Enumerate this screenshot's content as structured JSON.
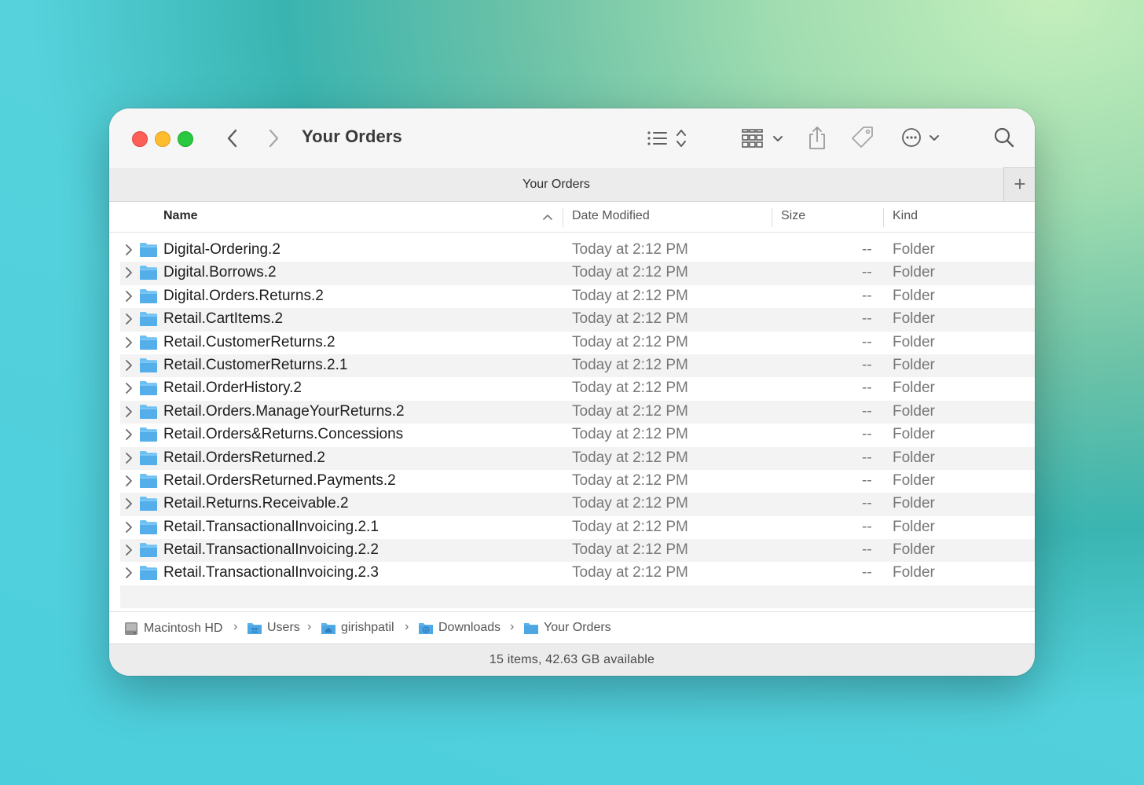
{
  "window": {
    "title": "Your Orders"
  },
  "toolbar": {
    "back_icon": "chevron-left-icon",
    "forward_icon": "chevron-right-icon",
    "view_icon": "list-view-icon",
    "group_icon": "grid-group-icon",
    "share_icon": "share-icon",
    "tag_icon": "tag-icon",
    "more_icon": "ellipsis-circle-icon",
    "search_icon": "search-icon"
  },
  "tab": {
    "title": "Your Orders",
    "add_label": "+"
  },
  "columns": {
    "name": "Name",
    "date": "Date Modified",
    "size": "Size",
    "kind": "Kind"
  },
  "files": [
    {
      "name": "Digital-Ordering.2",
      "date": "Today at 2:12 PM",
      "size": "--",
      "kind": "Folder"
    },
    {
      "name": "Digital.Borrows.2",
      "date": "Today at 2:12 PM",
      "size": "--",
      "kind": "Folder"
    },
    {
      "name": "Digital.Orders.Returns.2",
      "date": "Today at 2:12 PM",
      "size": "--",
      "kind": "Folder"
    },
    {
      "name": "Retail.CartItems.2",
      "date": "Today at 2:12 PM",
      "size": "--",
      "kind": "Folder"
    },
    {
      "name": "Retail.CustomerReturns.2",
      "date": "Today at 2:12 PM",
      "size": "--",
      "kind": "Folder"
    },
    {
      "name": "Retail.CustomerReturns.2.1",
      "date": "Today at 2:12 PM",
      "size": "--",
      "kind": "Folder"
    },
    {
      "name": "Retail.OrderHistory.2",
      "date": "Today at 2:12 PM",
      "size": "--",
      "kind": "Folder"
    },
    {
      "name": "Retail.Orders.ManageYourReturns.2",
      "date": "Today at 2:12 PM",
      "size": "--",
      "kind": "Folder"
    },
    {
      "name": "Retail.Orders&Returns.Concessions",
      "date": "Today at 2:12 PM",
      "size": "--",
      "kind": "Folder"
    },
    {
      "name": "Retail.OrdersReturned.2",
      "date": "Today at 2:12 PM",
      "size": "--",
      "kind": "Folder"
    },
    {
      "name": "Retail.OrdersReturned.Payments.2",
      "date": "Today at 2:12 PM",
      "size": "--",
      "kind": "Folder"
    },
    {
      "name": "Retail.Returns.Receivable.2",
      "date": "Today at 2:12 PM",
      "size": "--",
      "kind": "Folder"
    },
    {
      "name": "Retail.TransactionalInvoicing.2.1",
      "date": "Today at 2:12 PM",
      "size": "--",
      "kind": "Folder"
    },
    {
      "name": "Retail.TransactionalInvoicing.2.2",
      "date": "Today at 2:12 PM",
      "size": "--",
      "kind": "Folder"
    },
    {
      "name": "Retail.TransactionalInvoicing.2.3",
      "date": "Today at 2:12 PM",
      "size": "--",
      "kind": "Folder"
    }
  ],
  "path": [
    {
      "label": "Macintosh HD",
      "icon": "hard-drive-icon"
    },
    {
      "label": "Users",
      "icon": "users-folder-icon"
    },
    {
      "label": "girishpatil",
      "icon": "home-folder-icon"
    },
    {
      "label": "Downloads",
      "icon": "downloads-folder-icon"
    },
    {
      "label": "Your Orders",
      "icon": "folder-icon"
    }
  ],
  "status": {
    "text": "15 items, 42.63 GB available"
  },
  "colors": {
    "folder": "#5bb4ee",
    "close": "#fe5f57",
    "minimize": "#febc2e",
    "zoom": "#28c840"
  }
}
